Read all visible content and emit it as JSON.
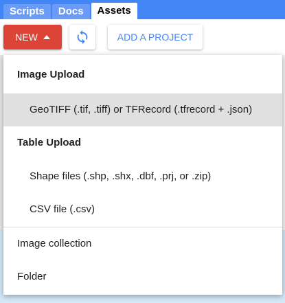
{
  "tabs": [
    {
      "label": "Scripts"
    },
    {
      "label": "Docs"
    },
    {
      "label": "Assets"
    }
  ],
  "toolbar": {
    "new_label": "NEW",
    "add_project_label": "ADD A PROJECT"
  },
  "menu": {
    "image_upload_header": "Image Upload",
    "geotiff_item": "GeoTIFF (.tif, .tiff) or TFRecord (.tfrecord + .json)",
    "table_upload_header": "Table Upload",
    "shape_files_item": "Shape files (.shp, .shx, .dbf, .prj, or .zip)",
    "csv_item": "CSV file (.csv)",
    "image_collection_item": "Image collection",
    "folder_item": "Folder"
  },
  "colors": {
    "tab_bar": "#4285f4",
    "new_button": "#db4437",
    "accent_text": "#4285f4",
    "menu_highlight": "#e0e0e0"
  }
}
